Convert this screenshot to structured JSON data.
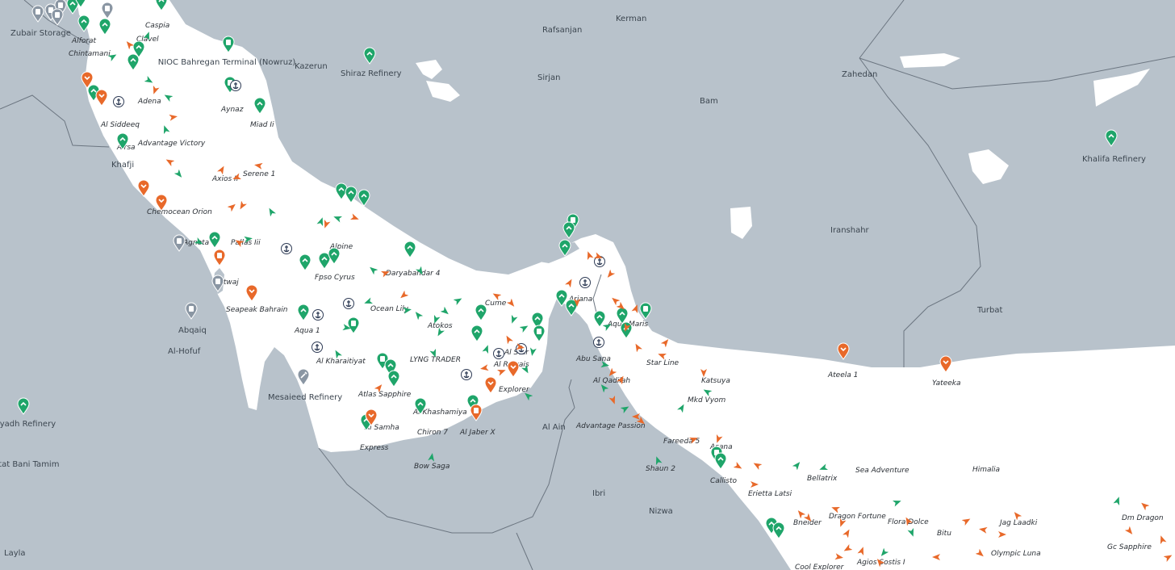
{
  "colors": {
    "sea": "#ffffff",
    "land": "#b8c2cb",
    "border": "#6b7580",
    "green": "#1fa56a",
    "orange": "#e8692a",
    "gray_pin": "#8a96a3",
    "port": "#2e3b55"
  },
  "places": [
    "Zubair Storage",
    "Kerman",
    "Rafsanjan",
    "Kazerun",
    "Sirjan",
    "Zahedan",
    "Bam",
    "Iranshahr",
    "Turbat",
    "Khafji",
    "Abqaiq",
    "Al-Hofuf",
    "Hotat Bani Tamim",
    "Layla",
    "Al Ain",
    "Ibri",
    "Nizwa"
  ],
  "facilities": [
    "NIOC Bahregan Terminal (Nowruz)",
    "Shiraz Refinery",
    "Khalifa Refinery",
    "Mesaieed Refinery",
    "Riyadh Refinery"
  ],
  "vessels": [
    "Alforat",
    "Caspia",
    "Clavel",
    "Chintamani",
    "Adena",
    "Aynaz",
    "Miad Ii",
    "Al Siddeeq",
    "Advantage Victory",
    "Alrsa",
    "Serene 1",
    "Axios Ii",
    "Chemocean Orion",
    "Agneta",
    "Pallas Iii",
    "Alpine",
    "Daryabandar 4",
    "Fpso Cyrus",
    "Antwaj",
    "Seapeak Bahrain",
    "Ocean Lily",
    "Cume",
    "Atokos",
    "Ariana",
    "Aqua 1",
    "Al Kharaitiyat",
    "LYNG TRADER",
    "Al Star",
    "Al Ruwais",
    "Atlas Sapphire",
    "Explorer",
    "Al Khashamiya",
    "Chiron 7",
    "Al Samha",
    "Al Jaber X",
    "Express",
    "Bow Saga",
    "Abu Sana",
    "Aqua Maris",
    "Star Line",
    "Al Qadilah",
    "Katsuya",
    "Mkd Vyom",
    "Advantage Passion",
    "Fareeda 5",
    "Asana",
    "Shaun 2",
    "Callisto",
    "Ateela 1",
    "Yateeka",
    "Sea Adventure",
    "Himalia",
    "Bellatrix",
    "Erietta Latsi",
    "Dragon Fortune",
    "Flora Dolce",
    "Bneider",
    "Bitu",
    "Jag Laadki",
    "Dm Dragon",
    "Olympic Luna",
    "Agios Sostis I",
    "Gc Sapphire",
    "Cool Explorer"
  ]
}
